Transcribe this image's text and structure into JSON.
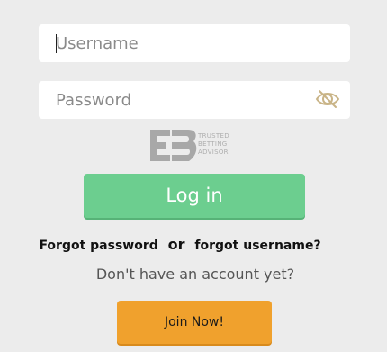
{
  "login_form": {
    "username": {
      "placeholder": "Username",
      "value": ""
    },
    "password": {
      "placeholder": "Password",
      "value": "",
      "toggle_icon": "eye-slash-icon"
    },
    "badge": {
      "icon": "trusted-betting-advisor-logo",
      "line1": "TRUSTED",
      "line2": "BETTING",
      "line3": "ADVISOR"
    },
    "login_label": "Log in",
    "forgot_password_label": "Forgot password",
    "or_label": "or",
    "forgot_username_label": "forgot username?",
    "no_account_text": "Don't have an account yet?",
    "join_label": "Join Now!"
  },
  "colors": {
    "background": "#ececec",
    "login_button": "#6cce8f",
    "join_button": "#f0a12d",
    "eye_icon": "#c9b487"
  }
}
